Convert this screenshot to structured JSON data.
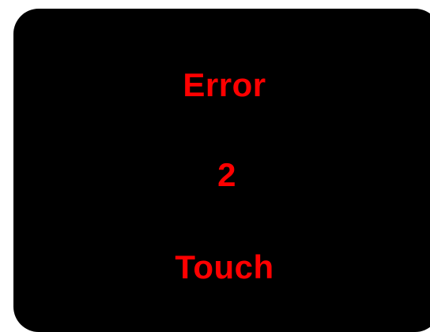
{
  "display": {
    "title": "Error",
    "code": "2",
    "action": "Touch"
  },
  "colors": {
    "background": "#000000",
    "text": "#ff0000",
    "frame": "#ffffff"
  }
}
